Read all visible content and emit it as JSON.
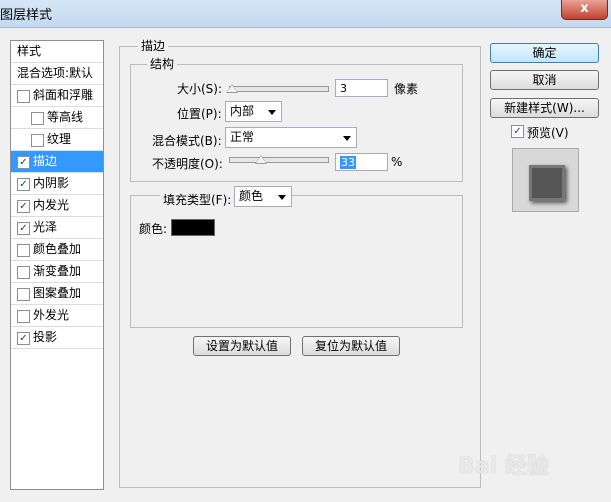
{
  "window": {
    "title": "图层样式",
    "close": "x"
  },
  "sidebar": {
    "items": [
      {
        "label": "样式",
        "type": "header",
        "checked": false
      },
      {
        "label": "混合选项:默认",
        "type": "header",
        "checked": false
      },
      {
        "label": "斜面和浮雕",
        "type": "normal",
        "checked": false
      },
      {
        "label": "等高线",
        "type": "indent",
        "checked": false
      },
      {
        "label": "纹理",
        "type": "indent",
        "checked": false
      },
      {
        "label": "描边",
        "type": "normal",
        "checked": true,
        "selected": true
      },
      {
        "label": "内阴影",
        "type": "normal",
        "checked": true
      },
      {
        "label": "内发光",
        "type": "normal",
        "checked": true
      },
      {
        "label": "光泽",
        "type": "normal",
        "checked": true
      },
      {
        "label": "颜色叠加",
        "type": "normal",
        "checked": false
      },
      {
        "label": "渐变叠加",
        "type": "normal",
        "checked": false
      },
      {
        "label": "图案叠加",
        "type": "normal",
        "checked": false
      },
      {
        "label": "外发光",
        "type": "normal",
        "checked": false
      },
      {
        "label": "投影",
        "type": "normal",
        "checked": true
      }
    ]
  },
  "stroke": {
    "title": "描边",
    "structure": {
      "title": "结构",
      "size_label": "大小(S):",
      "size_value": "3",
      "size_unit": "像素",
      "size_level": 0.03,
      "position_label": "位置(P):",
      "position_value": "内部",
      "blend_label": "混合模式(B):",
      "blend_value": "正常",
      "opacity_label": "不透明度(O):",
      "opacity_value": "33",
      "opacity_unit": "%",
      "opacity_level": 0.33
    },
    "fill": {
      "type_label": "填充类型(F):",
      "type_value": "颜色",
      "color_label": "颜色:",
      "color": "#000000"
    },
    "make_default": "设置为默认值",
    "reset_default": "复位为默认值"
  },
  "actions": {
    "ok": "确定",
    "cancel": "取消",
    "new_style": "新建样式(W)...",
    "preview_label": "预览(V)",
    "preview_checked": true
  },
  "watermark": "Bai 经验"
}
